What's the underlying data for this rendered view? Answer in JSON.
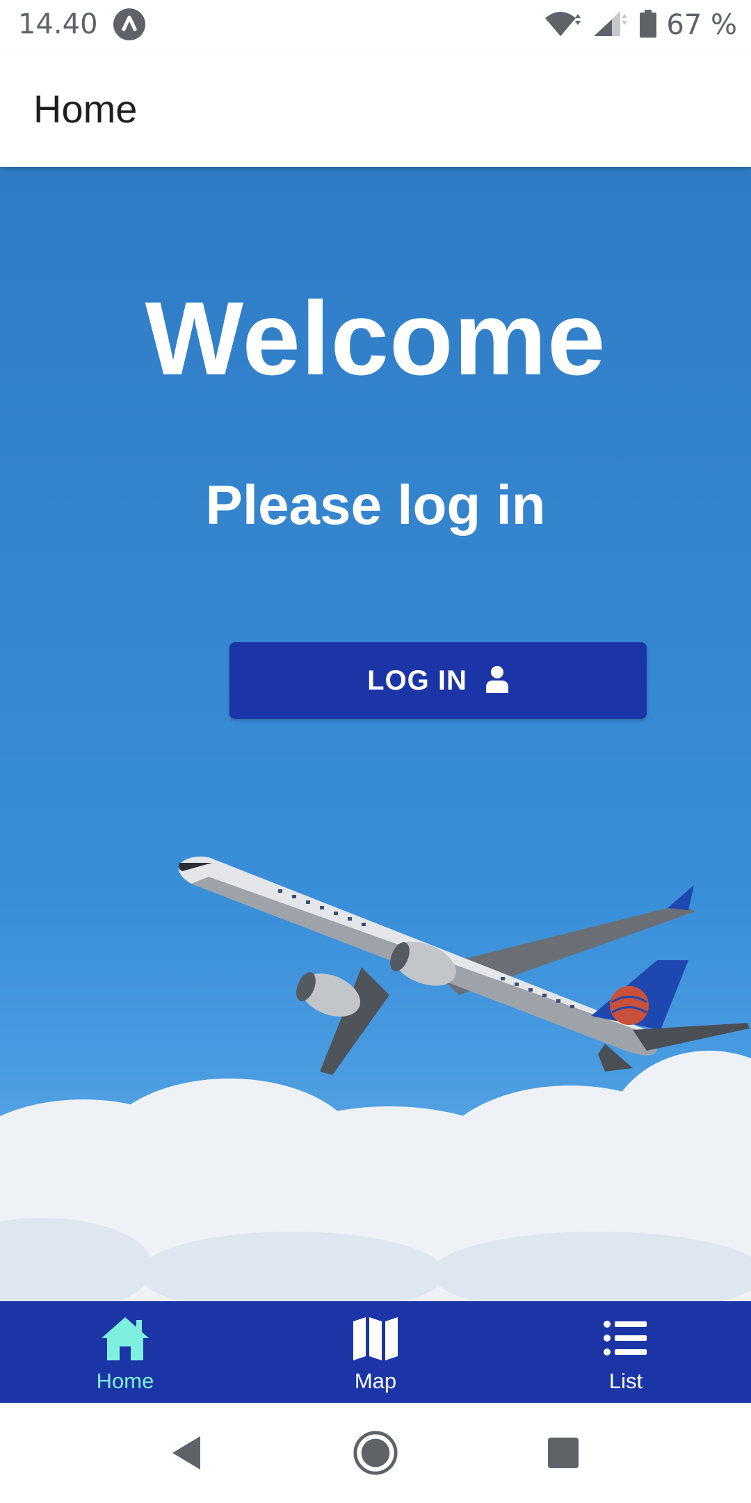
{
  "status_bar": {
    "time": "14.40",
    "battery_text": "67 %"
  },
  "app_bar": {
    "title": "Home"
  },
  "hero": {
    "title": "Welcome",
    "subtitle": "Please log in",
    "login_label": "LOG IN",
    "login_icon": "user-icon"
  },
  "tabs": [
    {
      "label": "Home",
      "icon": "home-icon",
      "active": true
    },
    {
      "label": "Map",
      "icon": "map-icon",
      "active": false
    },
    {
      "label": "List",
      "icon": "list-icon",
      "active": false
    }
  ],
  "nav": {
    "back_icon": "back-icon",
    "home_icon": "home-circle-icon",
    "recents_icon": "recents-icon"
  },
  "colors": {
    "accent": "#1c35a6",
    "active_tab": "#7ff0e0",
    "sky": "#3585cf"
  }
}
